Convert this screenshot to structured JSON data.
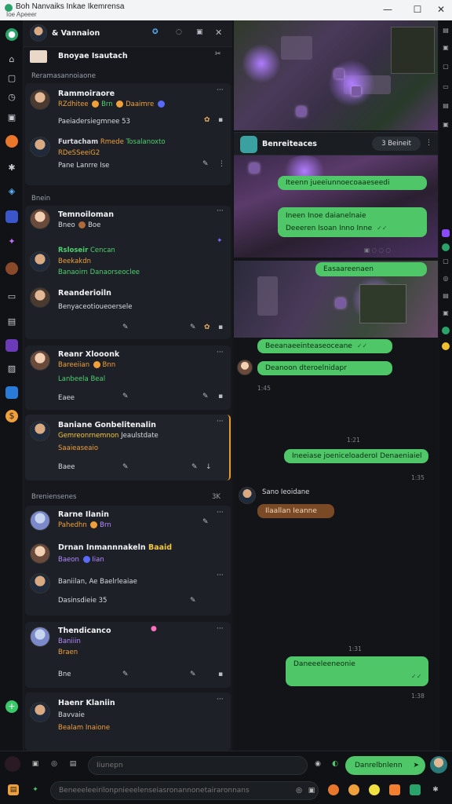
{
  "window": {
    "title": "Boh Nanvaiks Inkae  Ikemrensa",
    "subtitle": "Ioe Apeeer",
    "minimize": "—",
    "maximize": "☐",
    "close": "✕"
  },
  "list_header": {
    "title": "& Vannaion",
    "pinned": "Bnoyae Isautach",
    "section_recent": "Reramasannoiaone",
    "section_group": "Bnein",
    "section_archived": "Breniensenes",
    "section_archived_count": "3K"
  },
  "chats": [
    {
      "name": "Rammoiraore",
      "line1": "RZdhitee",
      "line1b": "Brn",
      "line1c": "Daaimre",
      "line2": "Paeiadersiegmnee",
      "line2b": "53"
    },
    {
      "name": "Furtacham",
      "name2": "Rmede",
      "name3": "Tosalanoxto",
      "line1": "RDeSSeeiG2",
      "line2": "Pane Lanrre",
      "line2b": "Ise"
    },
    {
      "name": "Temnoiloman",
      "line1": "Bneo",
      "line1b": "Boe"
    },
    {
      "name": "Rsloseir",
      "name2": "Cencan",
      "line1": "Beekakdn",
      "line2": "Banaoirn Danaorseoclee"
    },
    {
      "name": "Reanderioiln",
      "line1": "Benyaceotioueoersele"
    },
    {
      "name": "Reanr Xlooonk",
      "line1": "Bareeiian",
      "line1b": "Bnn",
      "line2": "Lanbeela Beal",
      "line3": "Eaee"
    },
    {
      "name": "Baniane Gonbelitenalin",
      "line1": "Gemreonrnemnon",
      "line1b": "Jeaulstdate",
      "line2": "Saaieaseaio",
      "line3": "Baee"
    },
    {
      "name": "Rarne Ilanin",
      "line1": "Pahedhn",
      "line1b": "Brn",
      "line2": "Drnan Inmannnakeln",
      "line2b": "Baaid",
      "line3": "Baeon",
      "line3b": "Iian",
      "line4": "Baniilan, Ae Baelrleaiae",
      "line5": "Dasinsdieie",
      "line5b": "35"
    },
    {
      "name": "Thendicanco",
      "line1": "Baniiin",
      "line2": "Braen",
      "line3": "Bne"
    },
    {
      "name": "Haenr Klaniin",
      "line1": "Bavvaie",
      "line2": "Bealam Inaione"
    }
  ],
  "conversation": {
    "title": "Benreiteaces",
    "members_button": "3 Beineit",
    "more": "⋮",
    "bubble1": "Iteenn jueeiunnoecoaaeseedi",
    "bubble2a": "Ineen Inoe daianelnaie",
    "bubble2b": "Deeeren Isoan Inno Inne",
    "bubble3": "Easaareenaen",
    "bubble4": "Beeanaeeinteaseoceane",
    "bubble5": "Deanoon dteroelnidapr",
    "time_a": "1:45",
    "day_divider": "1:21",
    "bubble6": "Ineeiase joeniceloaderoI Denaeniaiel",
    "time_b": "1:35",
    "sender": "Sano Ieoidane",
    "bubble7": "Ilaallan Ieanne",
    "day_divider2": "1:31",
    "bubble8": "Daneeeleeneonie",
    "time_c": "1:38"
  },
  "composer": {
    "placeholder_top": "Iiunepn",
    "send_label": "Danrelbnlenn",
    "placeholder_bottom": "Beneeeleeirilonpnieeelenseiasronannonetairaronnans"
  },
  "colors": {
    "accent_green": "#4fc768",
    "accent_orange": "#f0a03a",
    "accent_purple": "#b38bff"
  }
}
